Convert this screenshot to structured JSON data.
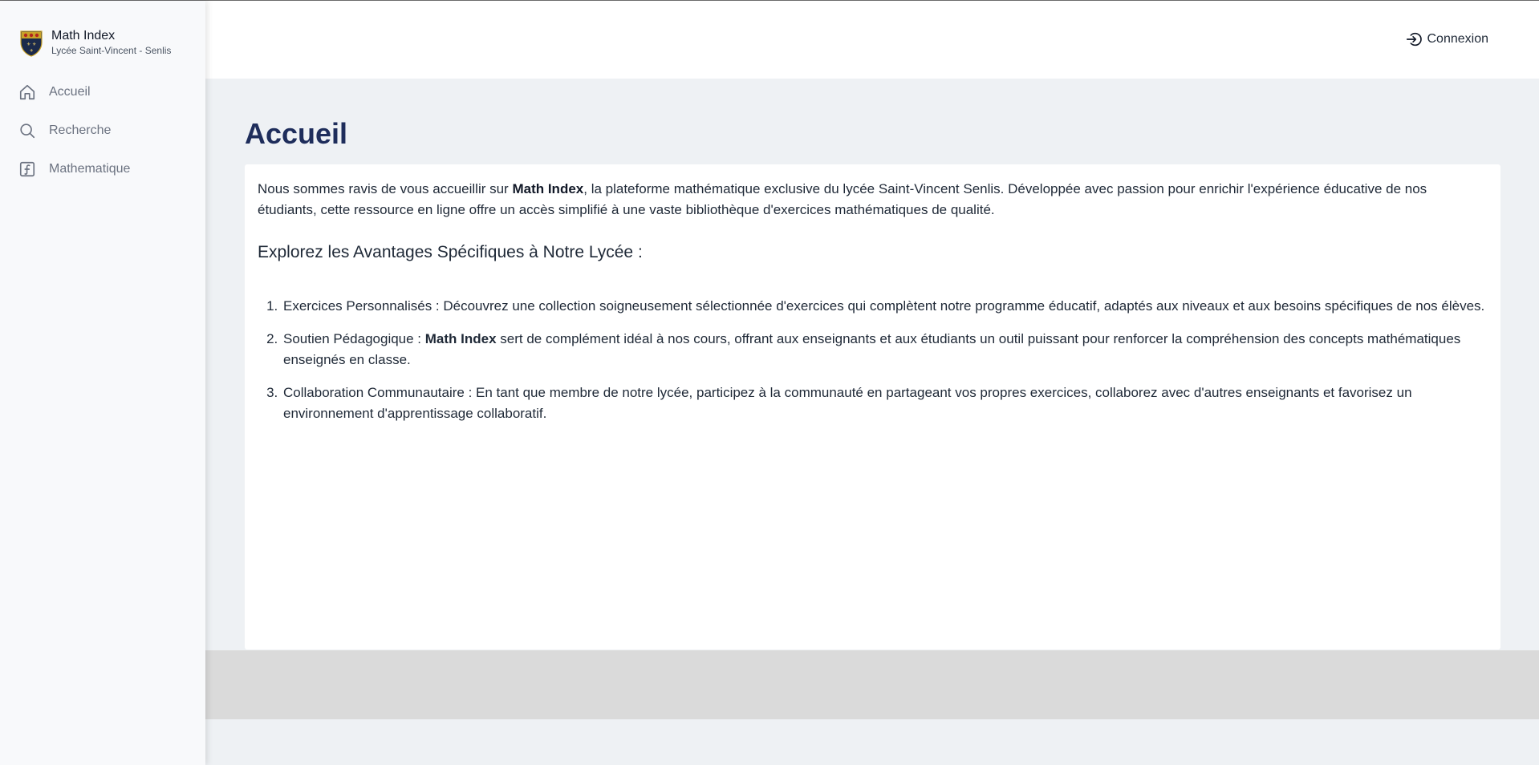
{
  "brand": {
    "title": "Math Index",
    "subtitle": "Lycée Saint-Vincent - Senlis",
    "logo_icon": "school-crest-icon"
  },
  "sidebar": {
    "items": [
      {
        "label": "Accueil",
        "icon": "home-icon"
      },
      {
        "label": "Recherche",
        "icon": "search-icon"
      },
      {
        "label": "Mathematique",
        "icon": "function-icon"
      }
    ]
  },
  "header": {
    "login_label": "Connexion",
    "login_icon": "login-icon"
  },
  "main": {
    "title": "Accueil",
    "intro": {
      "part1": "Nous sommes ravis de vous accueillir sur ",
      "bold": "Math Index",
      "part2": ", la plateforme mathématique exclusive du lycée Saint-Vincent Senlis. Développée avec passion pour enrichir l'expérience éducative de nos étudiants, cette ressource en ligne offre un accès simplifié à une vaste bibliothèque d'exercices mathématiques de qualité."
    },
    "subheading": "Explorez les Avantages Spécifiques à Notre Lycée :",
    "list": [
      {
        "text": "Exercices Personnalisés : Découvrez une collection soigneusement sélectionnée d'exercices qui complètent notre programme éducatif, adaptés aux niveaux et aux besoins spécifiques de nos élèves."
      },
      {
        "prefix": "Soutien Pédagogique : ",
        "bold": "Math Index",
        "suffix": " sert de complément idéal à nos cours, offrant aux enseignants et aux étudiants un outil puissant pour renforcer la compréhension des concepts mathématiques enseignés en classe."
      },
      {
        "text": "Collaboration Communautaire : En tant que membre de notre lycée, participez à la communauté en partageant vos propres exercices, collaborez avec d'autres enseignants et favorisez un environnement d'apprentissage collaboratif."
      }
    ]
  },
  "colors": {
    "title": "#1e2d5b",
    "sidebar_bg": "#f8f9fb",
    "main_bg": "#eef1f4",
    "footer_band": "#dadada"
  }
}
